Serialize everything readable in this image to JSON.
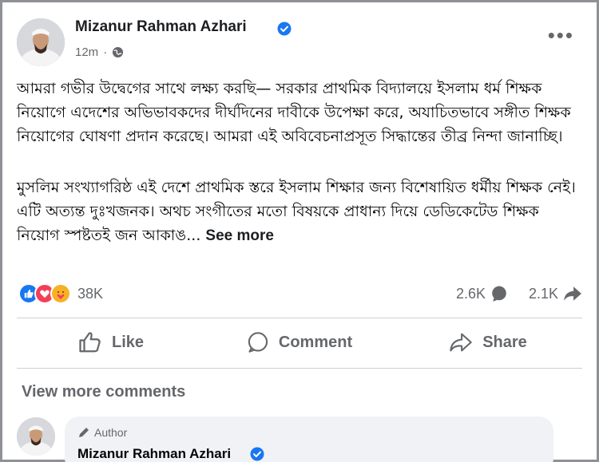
{
  "post": {
    "author": "Mizanur Rahman Azhari",
    "time": "12m",
    "separator": "·",
    "paragraph1": "আমরা গভীর উদ্বেগের সাথে লক্ষ্য করছি— সরকার প্রাথমিক বিদ্যালয়ে ইসলাম ধর্ম শিক্ষক নিয়োগে এদেশের অভিভাবকদের দীর্ঘদিনের দাবীকে উপেক্ষা করে, অযাচিতভাবে সঙ্গীত শিক্ষক নিয়োগের ঘোষণা প্রদান করেছে। আমরা এই অবিবেচনাপ্রসূত সিদ্ধান্তের তীব্র নিন্দা জানাচ্ছি।",
    "paragraph2": "মুসলিম সংখ্যাগরিষ্ঠ এই দেশে প্রাথমিক স্তরে ইসলাম শিক্ষার জন্য বিশেষায়িত ধর্মীয় শিক্ষক নেই। এটি অত্যন্ত দুঃখজনক। অথচ সংগীতের মতো বিষয়কে প্রাধান্য দিয়ে ডেডিকেটেড শিক্ষক নিয়োগ স্পষ্টতই জন আকাঙ...",
    "see_more": "See more"
  },
  "stats": {
    "reactions_count": "38K",
    "comments_count": "2.6K",
    "shares_count": "2.1K"
  },
  "actions": {
    "like": "Like",
    "comment": "Comment",
    "share": "Share"
  },
  "comments": {
    "view_more": "View more comments",
    "first": {
      "badge": "Author",
      "name": "Mizanur Rahman Azhari"
    }
  },
  "colors": {
    "like_blue": "#1877f2",
    "love_red": "#f33e58",
    "care_yellow": "#f7b125",
    "verified_blue": "#1877f2",
    "secondary_text": "#65676b"
  },
  "icons": [
    "verified-badge-icon",
    "globe-icon",
    "more-icon",
    "like-reaction-icon",
    "love-reaction-icon",
    "care-reaction-icon",
    "comment-bubble-icon",
    "share-arrow-icon",
    "thumbs-up-icon",
    "speech-bubble-icon",
    "share-icon",
    "pencil-icon"
  ]
}
